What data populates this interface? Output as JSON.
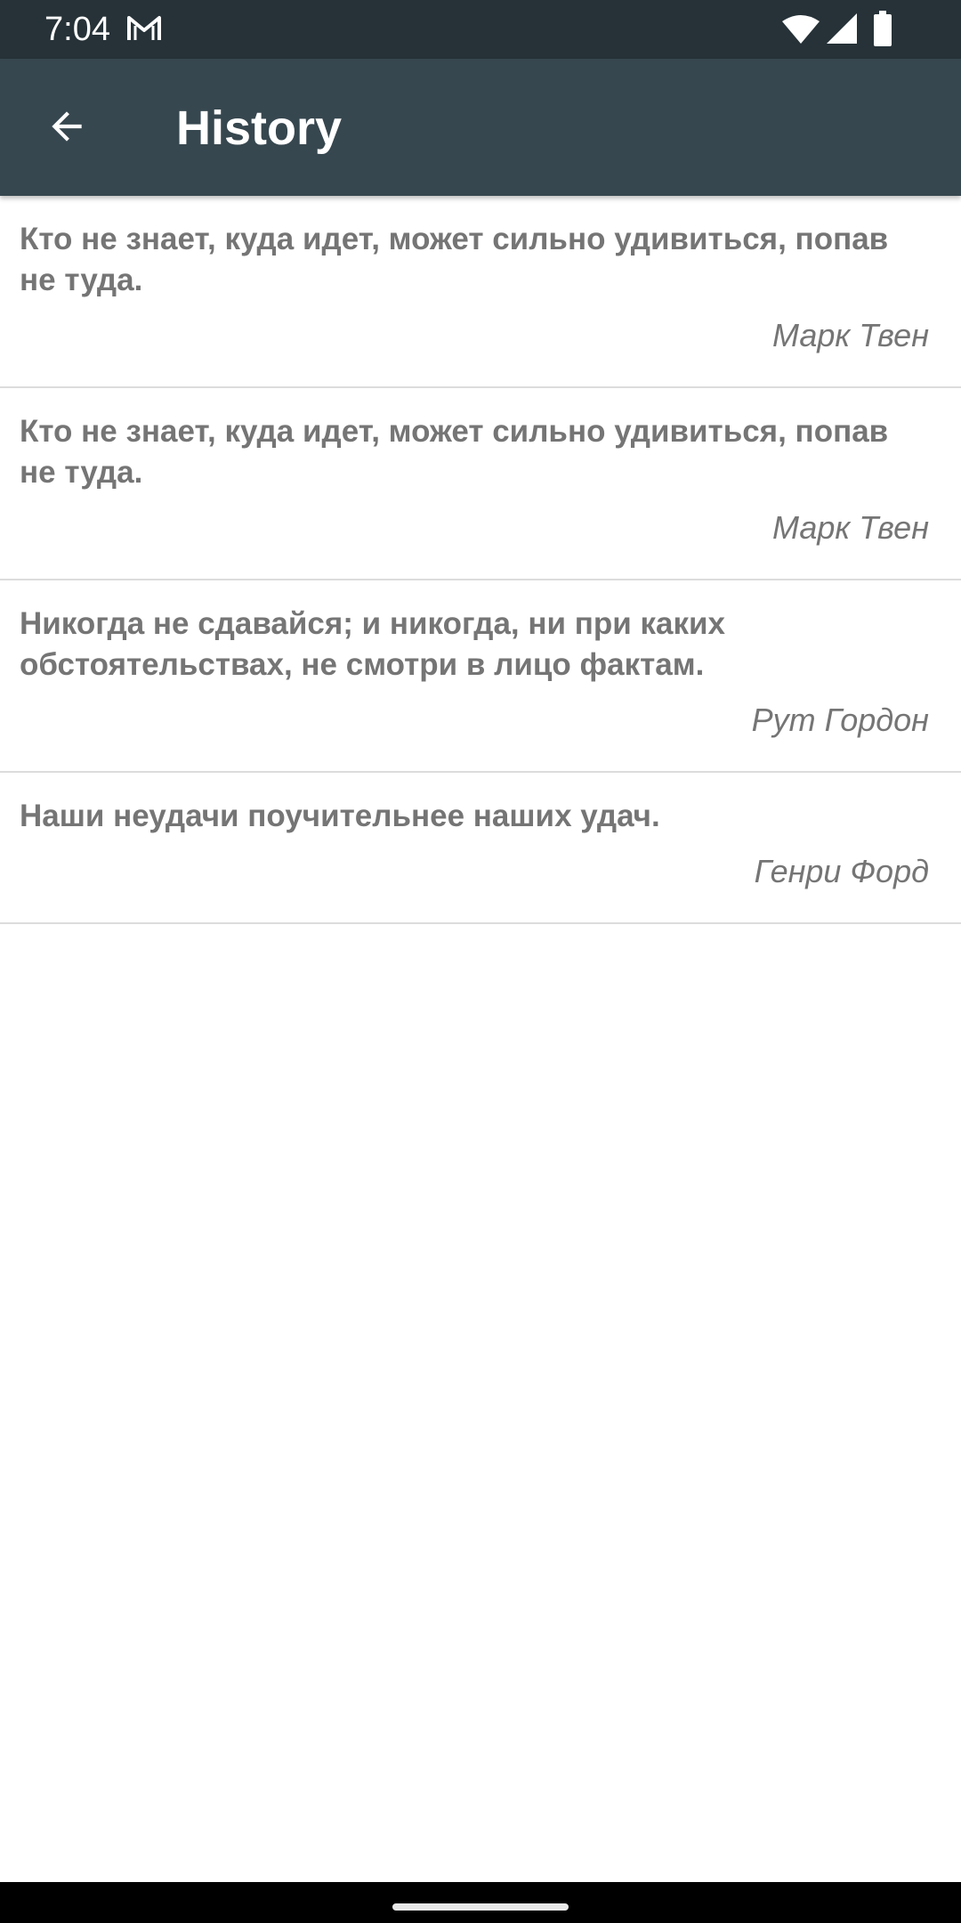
{
  "status_bar": {
    "time": "7:04",
    "icons": [
      "gmail-icon",
      "wifi-icon",
      "cell-signal-icon",
      "battery-icon"
    ]
  },
  "app_bar": {
    "title": "History",
    "back_icon": "arrow-back-icon",
    "background_color": "#37474f"
  },
  "history": {
    "items": [
      {
        "quote": "Кто не знает, куда идет, может сильно удивиться, попав не туда.",
        "author": "Марк Твен"
      },
      {
        "quote": "Кто не знает, куда идет, может сильно удивиться, попав не туда.",
        "author": "Марк Твен"
      },
      {
        "quote": "Никогда не сдавайся; и никогда, ни при каких обстоятельствах, не смотри в лицо фактам.",
        "author": "Рут Гордон"
      },
      {
        "quote": "Наши неудачи поучительнее наших удач.",
        "author": "Генри Форд"
      }
    ]
  }
}
